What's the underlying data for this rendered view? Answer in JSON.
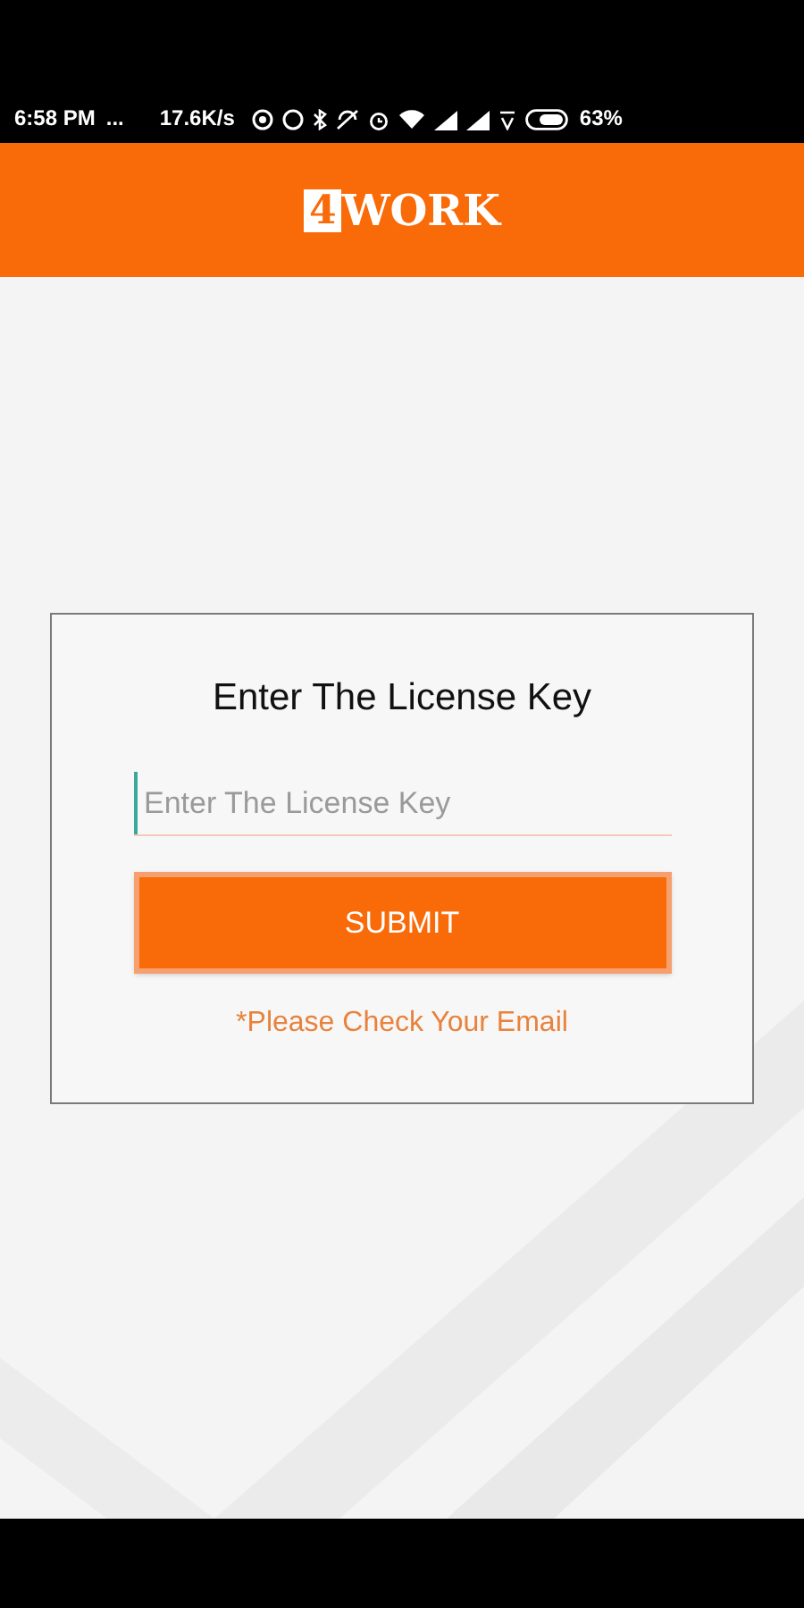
{
  "status_bar": {
    "time": "6:58 PM",
    "more": "...",
    "speed": "17.6K/s",
    "battery": "63%"
  },
  "header": {
    "logo_badge": "4",
    "logo_text": "WORK"
  },
  "card": {
    "title": "Enter The License Key",
    "field": {
      "placeholder": "Enter The License Key",
      "focused": true
    },
    "button": "SUBMIT",
    "note": "*Please Check Your Email"
  }
}
